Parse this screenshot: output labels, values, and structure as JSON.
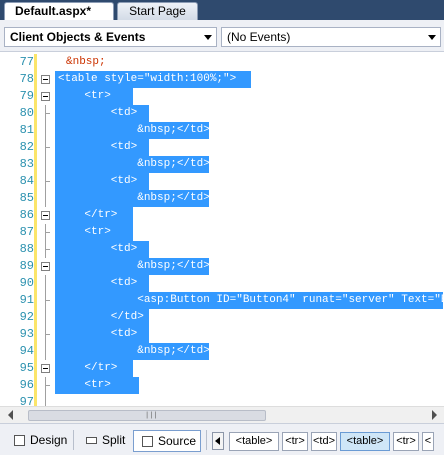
{
  "tabs": [
    {
      "label": "Default.aspx*",
      "active": true
    },
    {
      "label": "Start Page",
      "active": false
    }
  ],
  "dropdowns": {
    "objects": "Client Objects & Events",
    "events": "(No Events)"
  },
  "editor": {
    "lines": [
      {
        "num": "77",
        "text": "&nbsp;",
        "selected": false
      },
      {
        "num": "78",
        "text": "<table style=\"width:100%;\">",
        "selected": true
      },
      {
        "num": "79",
        "text": "    <tr>",
        "selected": true
      },
      {
        "num": "80",
        "text": "        <td>",
        "selected": true
      },
      {
        "num": "81",
        "text": "            &nbsp;</td>",
        "selected": true
      },
      {
        "num": "82",
        "text": "        <td>",
        "selected": true
      },
      {
        "num": "83",
        "text": "            &nbsp;</td>",
        "selected": true
      },
      {
        "num": "84",
        "text": "        <td>",
        "selected": true
      },
      {
        "num": "85",
        "text": "            &nbsp;</td>",
        "selected": true
      },
      {
        "num": "86",
        "text": "    </tr>",
        "selected": true
      },
      {
        "num": "87",
        "text": "    <tr>",
        "selected": true
      },
      {
        "num": "88",
        "text": "        <td>",
        "selected": true
      },
      {
        "num": "89",
        "text": "            &nbsp;</td>",
        "selected": true
      },
      {
        "num": "90",
        "text": "        <td>",
        "selected": true
      },
      {
        "num": "91",
        "text": "            <asp:Button ID=\"Button4\" runat=\"server\" Text=\"B",
        "selected": true
      },
      {
        "num": "92",
        "text": "        </td>",
        "selected": true
      },
      {
        "num": "93",
        "text": "        <td>",
        "selected": true
      },
      {
        "num": "94",
        "text": "            &nbsp;</td>",
        "selected": true
      },
      {
        "num": "95",
        "text": "    </tr>",
        "selected": true
      },
      {
        "num": "96",
        "text": "    <tr>",
        "selected": true
      },
      {
        "num": "97",
        "text": "",
        "selected": false
      }
    ]
  },
  "scrollbar": {
    "grip": "|||"
  },
  "views": {
    "design": "Design",
    "split": "Split",
    "source": "Source",
    "active": "Source"
  },
  "breadcrumbs": [
    "<table>",
    "<tr>",
    "<td>",
    "<table>",
    "<tr>",
    "<"
  ],
  "breadcrumb_active_index": 3,
  "colors": {
    "selection": "#3399ff",
    "line_number": "#2b91af",
    "tab_background": "#2f4a6e"
  }
}
